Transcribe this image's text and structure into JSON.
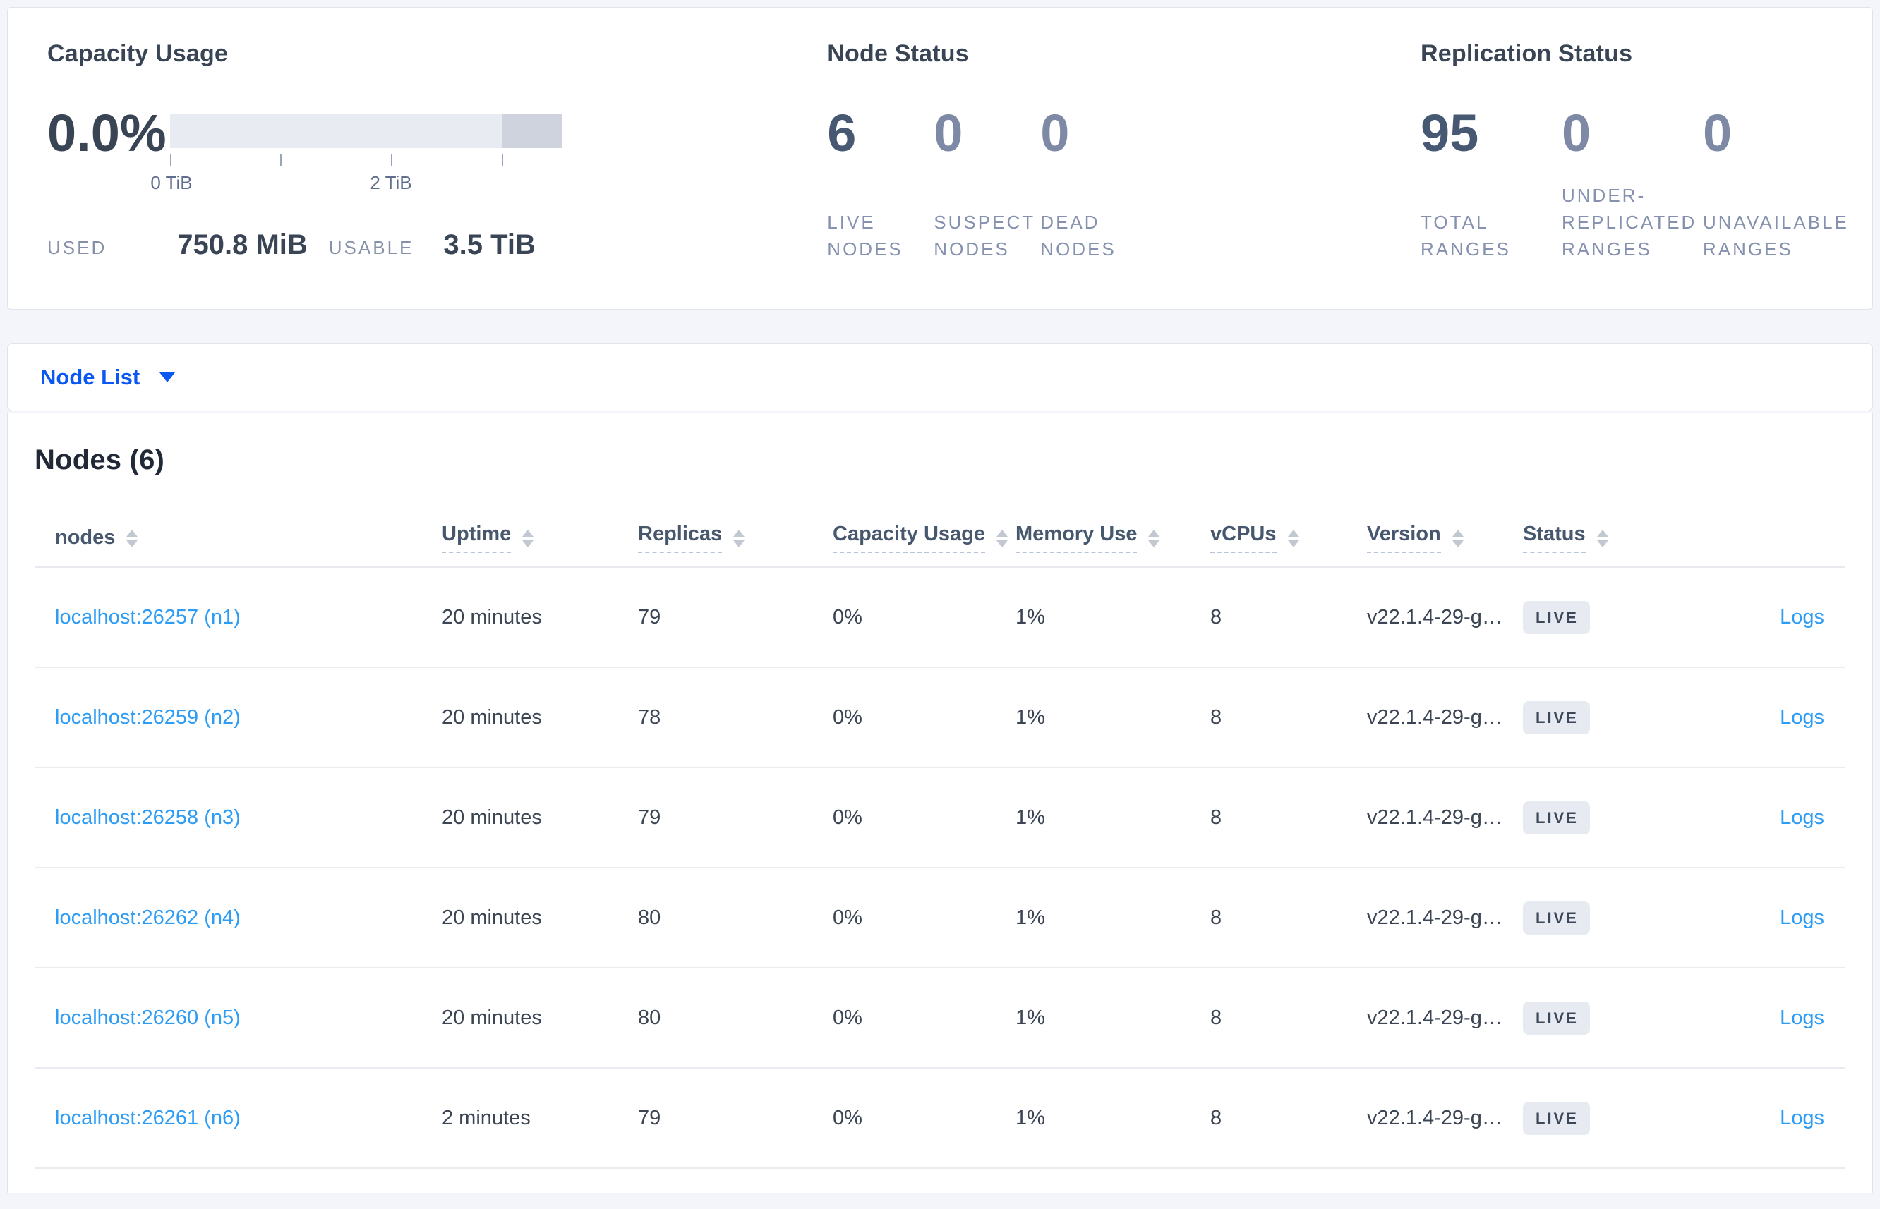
{
  "summary": {
    "capacity": {
      "title": "Capacity Usage",
      "percent": "0.0%",
      "axis_ticks": [
        "0 TiB",
        "2 TiB"
      ],
      "used_label": "USED",
      "used_value": "750.8 MiB",
      "usable_label": "USABLE",
      "usable_value": "3.5 TiB"
    },
    "node_status": {
      "title": "Node Status",
      "stats": [
        {
          "value": "6",
          "label": "LIVE NODES"
        },
        {
          "value": "0",
          "label": "SUSPECT NODES"
        },
        {
          "value": "0",
          "label": "DEAD NODES"
        }
      ]
    },
    "replication": {
      "title": "Replication Status",
      "stats": [
        {
          "value": "95",
          "label": "TOTAL RANGES"
        },
        {
          "value": "0",
          "label": "UNDER-REPLICATED RANGES"
        },
        {
          "value": "0",
          "label": "UNAVAILABLE RANGES"
        }
      ]
    }
  },
  "node_list": {
    "label": "Node List"
  },
  "table": {
    "heading": "Nodes (6)",
    "columns": [
      {
        "label": "nodes"
      },
      {
        "label": "Uptime"
      },
      {
        "label": "Replicas"
      },
      {
        "label": "Capacity Usage"
      },
      {
        "label": "Memory Use"
      },
      {
        "label": "vCPUs"
      },
      {
        "label": "Version"
      },
      {
        "label": "Status"
      }
    ],
    "rows": [
      {
        "node": "localhost:26257 (n1)",
        "uptime": "20 minutes",
        "replicas": "79",
        "capacity": "0%",
        "memory": "1%",
        "vcpus": "8",
        "version": "v22.1.4-29-g…",
        "status": "LIVE",
        "logs": "Logs"
      },
      {
        "node": "localhost:26259 (n2)",
        "uptime": "20 minutes",
        "replicas": "78",
        "capacity": "0%",
        "memory": "1%",
        "vcpus": "8",
        "version": "v22.1.4-29-g…",
        "status": "LIVE",
        "logs": "Logs"
      },
      {
        "node": "localhost:26258 (n3)",
        "uptime": "20 minutes",
        "replicas": "79",
        "capacity": "0%",
        "memory": "1%",
        "vcpus": "8",
        "version": "v22.1.4-29-g…",
        "status": "LIVE",
        "logs": "Logs"
      },
      {
        "node": "localhost:26262 (n4)",
        "uptime": "20 minutes",
        "replicas": "80",
        "capacity": "0%",
        "memory": "1%",
        "vcpus": "8",
        "version": "v22.1.4-29-g…",
        "status": "LIVE",
        "logs": "Logs"
      },
      {
        "node": "localhost:26260 (n5)",
        "uptime": "20 minutes",
        "replicas": "80",
        "capacity": "0%",
        "memory": "1%",
        "vcpus": "8",
        "version": "v22.1.4-29-g…",
        "status": "LIVE",
        "logs": "Logs"
      },
      {
        "node": "localhost:26261 (n6)",
        "uptime": "2 minutes",
        "replicas": "79",
        "capacity": "0%",
        "memory": "1%",
        "vcpus": "8",
        "version": "v22.1.4-29-g…",
        "status": "LIVE",
        "logs": "Logs"
      }
    ]
  },
  "colors": {
    "accent_blue": "#0b57f2",
    "link_blue": "#2d9cf4",
    "stat_dark": "#475872",
    "stat_muted": "#7d89a5",
    "badge_bg": "#e7eaf0",
    "bar_light": "#e9ebf2",
    "bar_dark": "#ced3de"
  }
}
